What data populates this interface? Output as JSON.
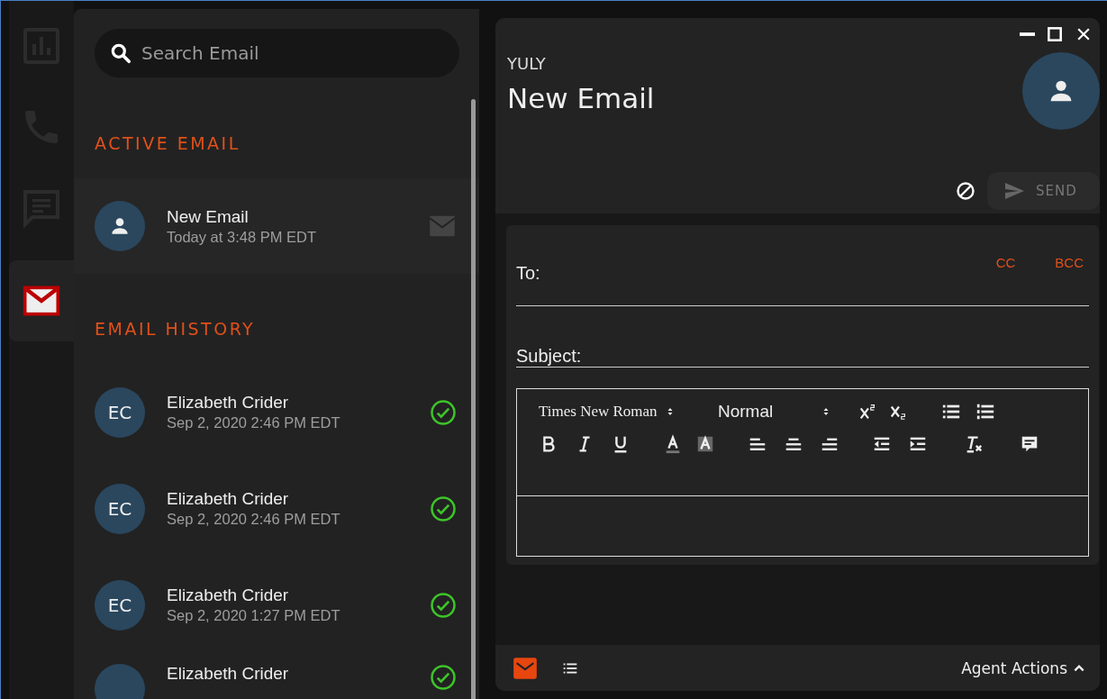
{
  "nav_rail": {
    "items": [
      {
        "kind": "chart",
        "selected": false
      },
      {
        "kind": "phone",
        "selected": false
      },
      {
        "kind": "chat",
        "selected": false
      },
      {
        "kind": "email",
        "selected": true
      }
    ]
  },
  "email_list": {
    "search": {
      "placeholder": "Search Email"
    },
    "active_section": {
      "title": "ACTIVE EMAIL",
      "items": [
        {
          "title": "New Email",
          "time": "Today at 3:48 PM EDT"
        }
      ]
    },
    "history_section": {
      "title": "EMAIL HISTORY",
      "items": [
        {
          "initials": "EC",
          "name": "Elizabeth Crider",
          "time": "Sep 2, 2020 2:46 PM EDT",
          "sent": true
        },
        {
          "initials": "EC",
          "name": "Elizabeth Crider",
          "time": "Sep 2, 2020 2:46 PM EDT",
          "sent": true
        },
        {
          "initials": "EC",
          "name": "Elizabeth Crider",
          "time": "Sep 2, 2020 1:27 PM EDT",
          "sent": true
        },
        {
          "name": "Elizabeth Crider",
          "sent": true
        }
      ]
    }
  },
  "compose": {
    "agent": "YULY",
    "title": "New Email",
    "send_button": {
      "label": "SEND",
      "disabled": true
    },
    "to_label": "To:",
    "cc": "CC",
    "bcc": "BCC",
    "subject_label": "Subject:",
    "editor": {
      "font": "Times New Roman",
      "size": "Normal"
    },
    "footer": {
      "actions": "Agent Actions"
    }
  }
}
